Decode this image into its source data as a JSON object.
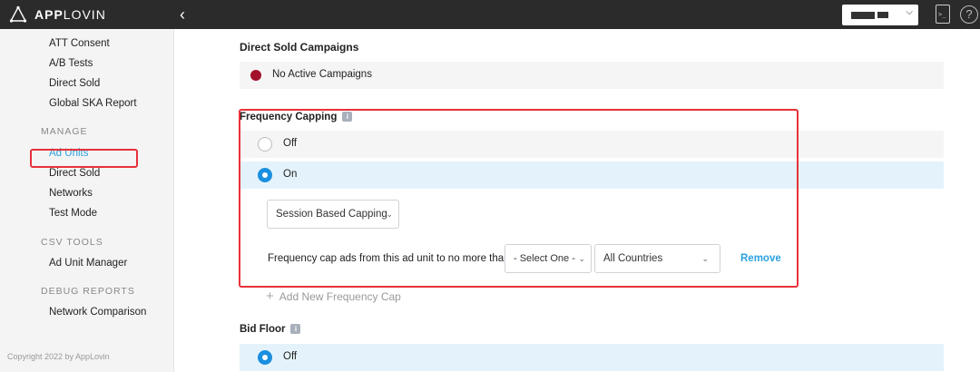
{
  "topbar": {
    "logo_bold": "APP",
    "logo_light": "LOVIN",
    "back_icon": "chevron-left-icon",
    "account_chevron": "⌵",
    "help_symbol": "?"
  },
  "sidebar": {
    "items_top": [
      "ATT Consent",
      "A/B Tests",
      "Direct Sold",
      "Global SKA Report"
    ],
    "manage_heading": "MANAGE",
    "manage_items": [
      "Ad Units",
      "Direct Sold",
      "Networks",
      "Test Mode"
    ],
    "csv_heading": "CSV TOOLS",
    "csv_items": [
      "Ad Unit Manager"
    ],
    "debug_heading": "DEBUG REPORTS",
    "debug_items": [
      "Network Comparison"
    ],
    "copyright": "Copyright 2022 by AppLovin"
  },
  "main": {
    "direct_sold_title": "Direct Sold Campaigns",
    "no_active_campaigns": "No Active Campaigns",
    "frequency_capping_title": "Frequency Capping",
    "fc_option_off": "Off",
    "fc_option_on": "On",
    "fc_selected": "On",
    "capping_type": "Session Based Capping",
    "fc_sentence": "Frequency cap ads from this ad unit to no more than",
    "select_one": "- Select One -",
    "countries": "All Countries",
    "remove": "Remove",
    "add_cap": "Add New Frequency Cap",
    "bid_floor_title": "Bid Floor",
    "bid_floor_off": "Off",
    "info_symbol": "i",
    "colors": {
      "accent_blue": "#1a8fe0",
      "link_blue": "#2aa1e0",
      "highlight_red": "#e8313a",
      "status_dot": "#a3102a"
    }
  }
}
